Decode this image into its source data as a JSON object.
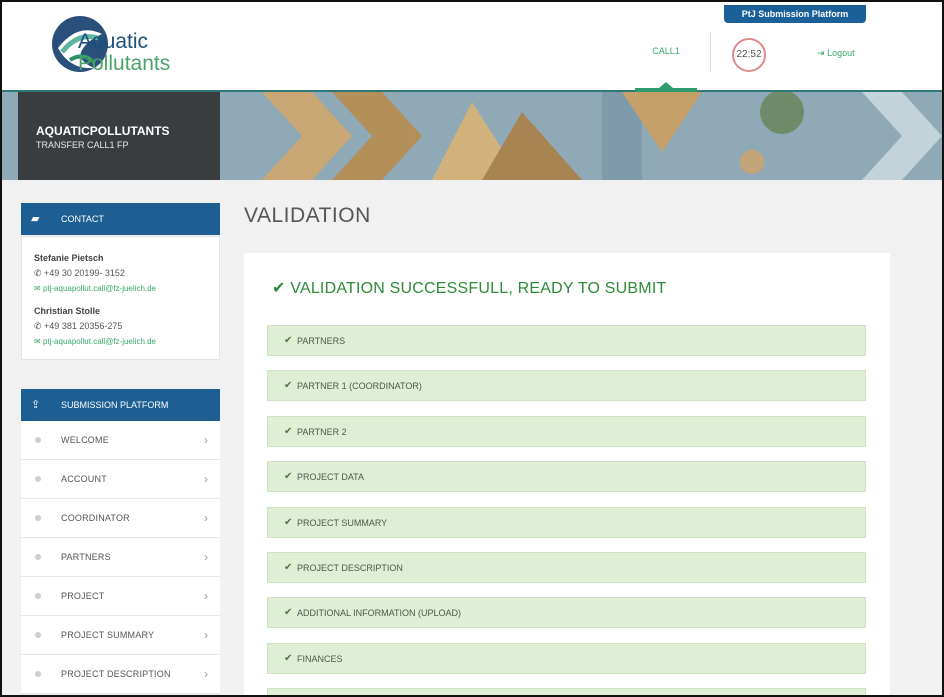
{
  "header": {
    "logo_line1": "Aquatic",
    "logo_line2": "Pollutants",
    "platform_badge": "PtJ Submission Platform",
    "call_tab": "CALL1",
    "timer": "22:52",
    "logout": "Logout"
  },
  "banner": {
    "title": "AQUATICPOLLUTANTS",
    "subtitle": "TRANSFER CALL1 FP"
  },
  "contact": {
    "heading": "CONTACT",
    "people": [
      {
        "name": "Stefanie Pietsch",
        "phone": "+49 30 20199- 3152",
        "email": "ptj-aquapollut.call@fz-juelich.de"
      },
      {
        "name": "Christian Stolle",
        "phone": "+49 381 20356-275",
        "email": "ptj-aquapollut.call@fz-juelich.de"
      }
    ]
  },
  "nav": {
    "heading": "SUBMISSION PLATFORM",
    "items": [
      {
        "label": "WELCOME"
      },
      {
        "label": "ACCOUNT"
      },
      {
        "label": "COORDINATOR"
      },
      {
        "label": "PARTNERS"
      },
      {
        "label": "PROJECT"
      },
      {
        "label": "PROJECT SUMMARY"
      },
      {
        "label": "PROJECT DESCRIPTION"
      }
    ]
  },
  "main": {
    "title": "VALIDATION",
    "status": "VALIDATION SUCCESSFULL, READY TO SUBMIT",
    "items": [
      {
        "label": "PARTNERS"
      },
      {
        "label": "PARTNER 1 (COORDINATOR)"
      },
      {
        "label": "PARTNER 2"
      },
      {
        "label": "PROJECT DATA"
      },
      {
        "label": "PROJECT SUMMARY"
      },
      {
        "label": "PROJECT DESCRIPTION"
      },
      {
        "label": "ADDITIONAL INFORMATION (UPLOAD)"
      },
      {
        "label": "FINANCES"
      }
    ]
  },
  "icons": {
    "check": "check-icon",
    "phone": "phone-icon",
    "mail": "mail-icon",
    "chevron": "chevron-right-icon"
  },
  "colors": {
    "primary": "#1d5f93",
    "accent_green": "#3aa86b",
    "success_green": "#2d8a3a",
    "validation_bg": "#dfefd6"
  }
}
